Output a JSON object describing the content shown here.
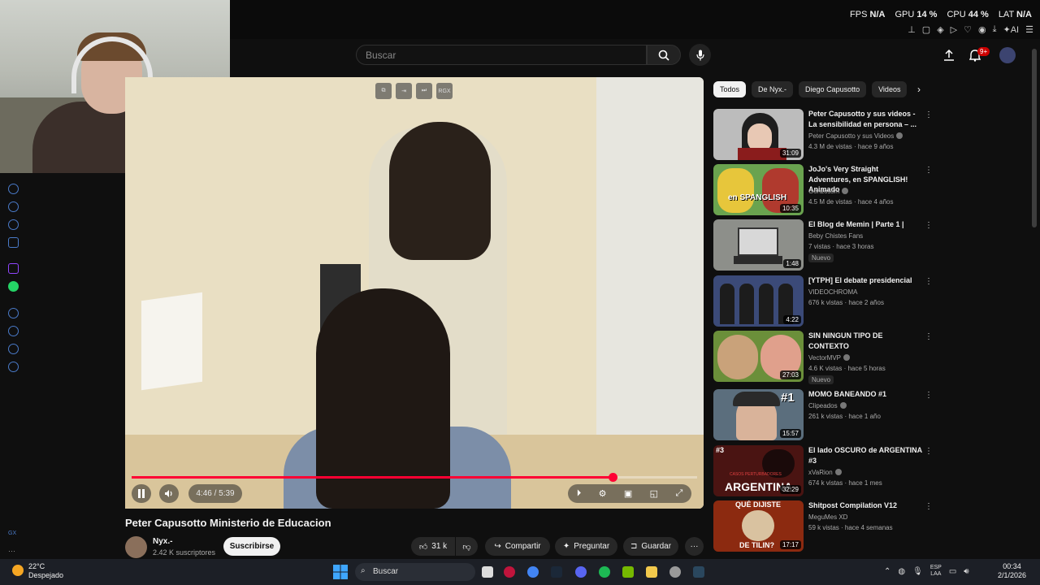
{
  "system_stats": {
    "fps_label": "FPS",
    "fps_value": "N/A",
    "gpu_label": "GPU",
    "gpu_value": "14 %",
    "cpu_label": "CPU",
    "cpu_value": "44 %",
    "lat_label": "LAT",
    "lat_value": "N/A"
  },
  "header": {
    "search_placeholder": "Buscar",
    "notification_count": "9+"
  },
  "video": {
    "time": "4:46 / 5:39",
    "progress": 0.85,
    "top_controls": [
      "",
      "",
      "",
      "RGX"
    ],
    "title": "Peter Capusotto Ministerio de Educacion"
  },
  "channel": {
    "name": "Nyx.-",
    "subscribers": "2.42 K suscriptores",
    "subscribe_label": "Suscribirse"
  },
  "actions": {
    "likes": "31 k",
    "share": "Compartir",
    "ask": "Preguntar",
    "save": "Guardar"
  },
  "chips": [
    "Todos",
    "De Nyx.-",
    "Diego Capusotto",
    "Videos"
  ],
  "recommendations": [
    {
      "title": "Peter Capusotto y sus videos - La sensibilidad en persona – ...",
      "channel": "Peter Capusotto y sus Videos",
      "meta": "4.3 M de vistas · hace 9 años",
      "duration": "31:09",
      "thumb_color": "#bcbcbc",
      "new": ""
    },
    {
      "title": "JoJo's Very Straight Adventures, en SPANGLISH! Animado ...",
      "channel": "Gonzossm",
      "meta": "4.5 M de vistas · hace 4 años",
      "duration": "10:35",
      "thumb_color": "#6aa34f",
      "new": ""
    },
    {
      "title": "El Blog de Memin | Parte 1 |",
      "channel": "Beby Chistes Fans",
      "meta": "7 vistas · hace 3 horas",
      "duration": "1:48",
      "thumb_color": "#8d8f8a",
      "new": "Nuevo"
    },
    {
      "title": "[YTPH] El debate presidencial",
      "channel": "VIDEOCHROMA",
      "meta": "676 k vistas · hace 2 años",
      "duration": "4:22",
      "thumb_color": "#3b4a78",
      "new": ""
    },
    {
      "title": "SIN NINGUN TIPO DE CONTEXTO",
      "channel": "VectorMVP",
      "meta": "4.6 K vistas · hace 5 horas",
      "duration": "27:03",
      "thumb_color": "#6b8f3a",
      "new": "Nuevo"
    },
    {
      "title": "MOMO BANEANDO #1",
      "channel": "Clipeados",
      "meta": "261 k vistas · hace 1 año",
      "duration": "15:57",
      "thumb_color": "#5b6e7d",
      "new": ""
    },
    {
      "title": "El lado OSCURO de ARGENTINA #3",
      "channel": "xVaRion",
      "meta": "674 k vistas · hace 1 mes",
      "duration": "32:29",
      "thumb_color": "#4a1412",
      "new": ""
    },
    {
      "title": "Shitpost Compilation V12",
      "channel": "MeguMes XD",
      "meta": "59 k vistas · hace 4 semanas",
      "duration": "17:17",
      "thumb_color": "#8c2a10",
      "new": ""
    }
  ],
  "thumb_texts": {
    "spanglish": "en SPANGLISH",
    "momo": "#1",
    "argentina_top": "#3",
    "argentina_small": "CASOS PERTURBADORES",
    "argentina_big": "ARGENTINA",
    "shitpost_top": "QUÉ DIJISTE",
    "shitpost_bottom": "DE TILIN?"
  },
  "taskbar": {
    "temperature": "22°C",
    "weather": "Despejado",
    "search": "Buscar",
    "lang": "ESP",
    "lang2": "LAA",
    "time": "00:34",
    "date": "2/1/2026"
  },
  "colors": {
    "accent_red": "#ff0033",
    "background": "#0f0f0f"
  }
}
